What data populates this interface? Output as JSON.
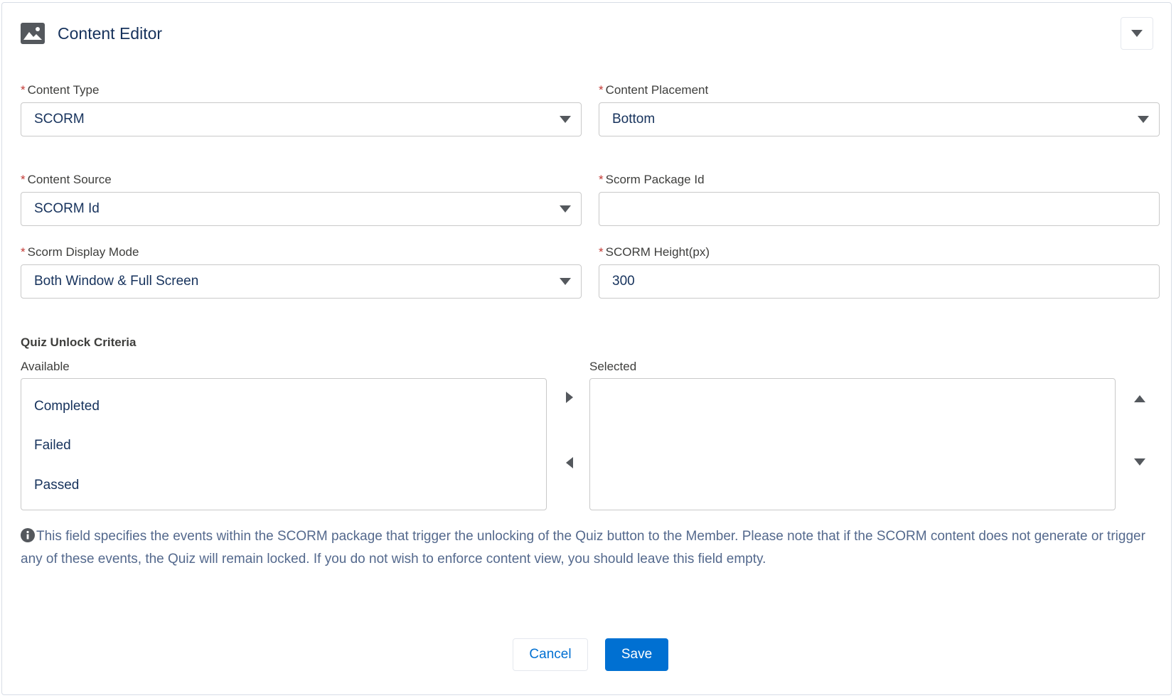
{
  "header": {
    "title": "Content Editor",
    "icon": "image-icon"
  },
  "fields": {
    "content_type": {
      "label": "Content Type",
      "value": "SCORM"
    },
    "content_placement": {
      "label": "Content Placement",
      "value": "Bottom"
    },
    "content_source": {
      "label": "Content Source",
      "value": "SCORM Id"
    },
    "scorm_package_id": {
      "label": "Scorm Package Id",
      "value": ""
    },
    "scorm_display_mode": {
      "label": "Scorm Display Mode",
      "value": "Both Window & Full Screen"
    },
    "scorm_height": {
      "label": "SCORM Height(px)",
      "value": "300"
    }
  },
  "required_marker": "*",
  "quiz_unlock": {
    "title": "Quiz Unlock Criteria",
    "available_label": "Available",
    "selected_label": "Selected",
    "available": [
      "Completed",
      "Failed",
      "Passed"
    ],
    "selected": []
  },
  "help_text": "This field specifies the events within the SCORM package that trigger the unlocking of the Quiz button to the Member. Please note that if the SCORM content does not generate or trigger any of these events, the Quiz will remain locked. If you do not wish to enforce content view, you should leave this field empty.",
  "buttons": {
    "cancel": "Cancel",
    "save": "Save"
  },
  "colors": {
    "brand": "#0070d2",
    "required": "#c23934",
    "text": "#16325c"
  }
}
